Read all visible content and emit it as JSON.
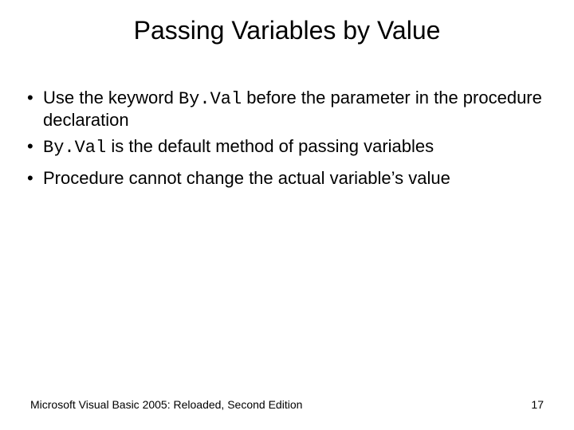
{
  "slide": {
    "title": "Passing Variables by Value",
    "bullets": {
      "b1_pre": "Use the keyword ",
      "b1_code": "By.Val",
      "b1_post": " before the parameter in the procedure declaration",
      "b2_code": "By.Val",
      "b2_post": " is the default method of passing variables",
      "b3": "Procedure cannot change the actual variable’s value"
    },
    "footer": {
      "source": "Microsoft Visual Basic 2005: Reloaded, Second Edition",
      "page": "17"
    }
  }
}
